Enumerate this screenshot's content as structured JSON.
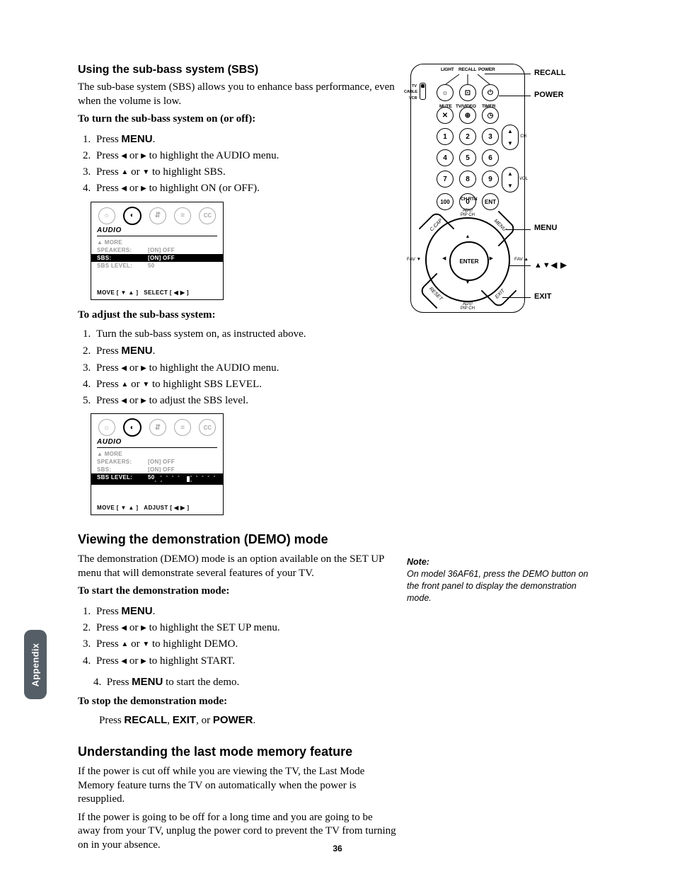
{
  "page_number": "36",
  "side_tab": "Appendix",
  "sbs": {
    "heading": "Using the sub-bass system (SBS)",
    "intro": "The sub-base system (SBS) allows you to enhance bass performance, even when the volume is low.",
    "turn_on_heading": "To turn the sub-bass system on (or off):",
    "steps_on": {
      "s1a": "Press ",
      "s1b": "MENU",
      "s1c": ".",
      "s2a": "Press ",
      "s2b": " or ",
      "s2c": " to highlight the AUDIO menu.",
      "s3a": "Press ",
      "s3b": " or ",
      "s3c": " to highlight SBS.",
      "s4a": "Press ",
      "s4b": " or ",
      "s4c": " to highlight ON (or OFF)."
    },
    "adjust_heading": "To adjust the sub-bass system:",
    "steps_adj": {
      "s1": "Turn the sub-bass system on, as instructed above.",
      "s2a": "Press ",
      "s2b": "MENU",
      "s2c": ".",
      "s3a": "Press ",
      "s3b": " or ",
      "s3c": " to highlight the AUDIO menu.",
      "s4a": "Press ",
      "s4b": " or ",
      "s4c": " to highlight SBS LEVEL.",
      "s5a": "Press ",
      "s5b": " or ",
      "s5c": " to adjust the SBS level."
    }
  },
  "osd": {
    "title": "AUDIO",
    "more": "▲ MORE",
    "row_speakers_lab": "SPEAKERS:",
    "row_speakers_val": "[ON] OFF",
    "row_sbs_lab": "SBS:",
    "row_sbs_val": "[ON] OFF",
    "row_sbslevel_lab": "SBS LEVEL:",
    "row_sbslevel_val": "50",
    "foot_move": "MOVE [ ▼ ▲ ]",
    "foot_select": "SELECT [ ◀  ▶ ]",
    "foot_adjust": "ADJUST [ ◀  ▶ ]",
    "icon_pic": "☼",
    "icon_aud": "◐",
    "icon_eq": "⇵",
    "icon_set": "≡",
    "icon_cc": "CC"
  },
  "demo": {
    "heading": "Viewing the demonstration (DEMO) mode",
    "intro": "The demonstration (DEMO) mode is an option available on the SET UP menu that will demonstrate several features of your TV.",
    "start_heading": "To start the demonstration mode:",
    "steps": {
      "s1a": "Press ",
      "s1b": "MENU",
      "s1c": ".",
      "s2a": "Press ",
      "s2b": " or ",
      "s2c": " to highlight the SET UP menu.",
      "s3a": "Press ",
      "s3b": " or ",
      "s3c": " to highlight DEMO.",
      "s4a": "Press ",
      "s4b": " or ",
      "s4c": " to highlight START.",
      "s5n": "4.",
      "s5a": "Press ",
      "s5b": "MENU",
      "s5c": " to start the demo."
    },
    "stop_heading": "To stop the demonstration mode:",
    "stop_a": "Press  ",
    "stop_b": "RECALL",
    "stop_c": ", ",
    "stop_d": "EXIT",
    "stop_e": ", or ",
    "stop_f": "POWER",
    "stop_g": "."
  },
  "lastmode": {
    "heading": "Understanding the last mode memory feature",
    "p1": "If the power is cut off while you are viewing the TV, the Last Mode Memory feature turns the TV on automatically when the power is resupplied.",
    "p2": "If the power is going to be off for a long time and you are going to be away from your TV, unplug the power cord to prevent the TV from turning on in your absence."
  },
  "note": {
    "head": "Note:",
    "body": "On model 36AF61, press the DEMO button on the front panel to display the demonstration mode."
  },
  "remote": {
    "top_labels": {
      "light": "LIGHT",
      "recall": "RECALL",
      "power": "POWER",
      "mute": "MUTE",
      "tvvideo": "TV/VIDEO",
      "timer": "TIMER"
    },
    "switch": {
      "tv": "TV",
      "cable": "CABLE",
      "vcr": "VCR"
    },
    "numbers": {
      "n1": "1",
      "n2": "2",
      "n3": "3",
      "n4": "4",
      "n5": "5",
      "n6": "6",
      "n7": "7",
      "n8": "8",
      "n9": "9",
      "n100": "100",
      "n0": "0",
      "ent": "ENT"
    },
    "ch": "CH",
    "vol": "VOL",
    "chrtn": "CH RTN",
    "dpad": {
      "enter": "ENTER",
      "favd": "FAV ▼",
      "favu": "FAV ▲",
      "adv": "ADV/",
      "pip": "PIP CH",
      "ccap": "C.CAP",
      "menu": "MENU",
      "reset": "RESET",
      "exit": "EXIT"
    },
    "callouts": {
      "recall": "RECALL",
      "power": "POWER",
      "menu": "MENU",
      "arrows": "▲▼◀ ▶",
      "exit": "EXIT"
    }
  }
}
